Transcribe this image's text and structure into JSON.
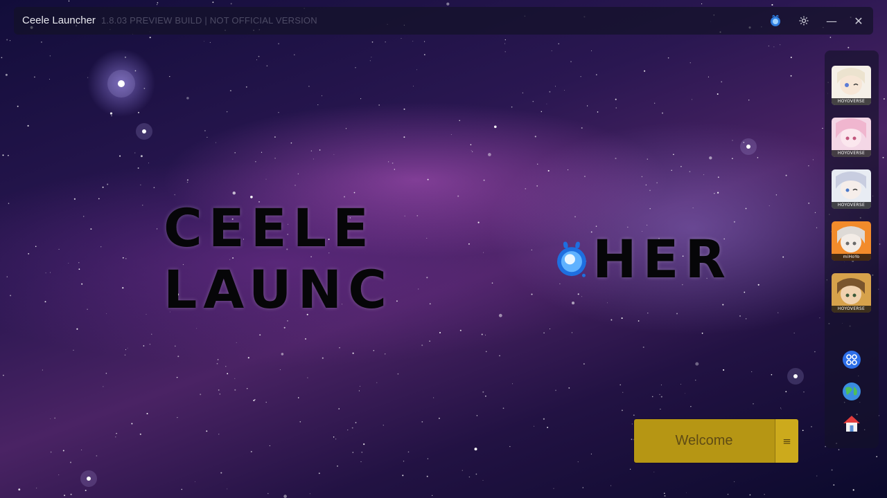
{
  "window": {
    "app_title": "Ceele Launcher",
    "build_label": "1.8.03 PREVIEW BUILD | NOT OFFICIAL VERSION",
    "controls": {
      "ceele_icon": "ceele-mascot-icon",
      "settings_icon": "gear-icon",
      "minimize_symbol": "—",
      "close_symbol": "✕"
    }
  },
  "hero": {
    "logo_text_left": "CEELE LAUNC",
    "logo_text_right": "HER"
  },
  "sidebar": {
    "games": [
      {
        "name": "game-1",
        "brand": "HOYOVERSE",
        "colors": [
          "#f5f0e8",
          "#d9c7a3"
        ]
      },
      {
        "name": "game-2",
        "brand": "HOYOVERSE",
        "colors": [
          "#f4d7e6",
          "#c27aa0"
        ]
      },
      {
        "name": "game-3",
        "brand": "HOYOVERSE",
        "colors": [
          "#e8ecf3",
          "#8f97b6"
        ]
      },
      {
        "name": "game-4",
        "brand": "miHoYo",
        "colors": [
          "#f28b2b",
          "#e9e4df"
        ]
      },
      {
        "name": "game-5",
        "brand": "HOYOVERSE",
        "colors": [
          "#d7a24b",
          "#5b4a2e"
        ]
      }
    ],
    "tools": [
      {
        "name": "network-tool-icon"
      },
      {
        "name": "globe-icon"
      },
      {
        "name": "home-icon"
      }
    ]
  },
  "welcome": {
    "label": "Welcome",
    "menu_symbol": "≡"
  },
  "colors": {
    "accent_yellow": "#b69614",
    "menu_yellow": "#ccaa1c"
  }
}
